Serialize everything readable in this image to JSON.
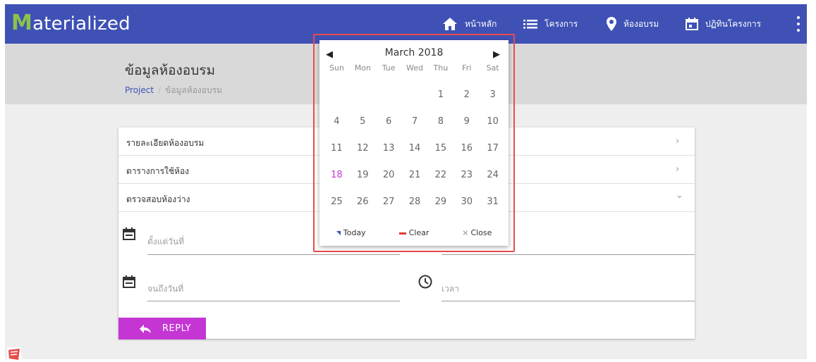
{
  "app": {
    "brand_first": "M",
    "brand_rest": "aterialized",
    "nav": [
      {
        "icon": "home-icon",
        "label": "หน้าหลัก"
      },
      {
        "icon": "list-icon",
        "label": "โครงการ"
      },
      {
        "icon": "location-pin-icon",
        "label": "ห้องอบรม"
      },
      {
        "icon": "calendar-icon",
        "label": "ปฏิทินโครงการ"
      }
    ],
    "colors": {
      "primary": "#3f51b5",
      "accent": "#c435d4",
      "brand_m": "#8bc34a",
      "highlight": "#e74c4c"
    }
  },
  "header": {
    "title": "ข้อมูลห้องอบรม",
    "breadcrumb": {
      "root": "Project",
      "separator": "/",
      "current": "ข้อมูลห้องอบรม"
    }
  },
  "accordion": [
    {
      "label": "รายละเอียดห้องอบรม",
      "chevron": "›"
    },
    {
      "label": "ตารางการใช้ห้อง",
      "chevron": "›"
    },
    {
      "label": "ตรวจสอบห้องว่าง",
      "chevron": "⌄"
    }
  ],
  "form": {
    "from_date_placeholder": "ตั้งแต่วันที่",
    "to_date_placeholder": "จนถึงวันที่",
    "time_placeholder": "เวลา",
    "reply_label": "REPLY"
  },
  "datepicker": {
    "month_label": "March 2018",
    "prev": "◀",
    "next": "▶",
    "weekdays": [
      "Sun",
      "Mon",
      "Tue",
      "Wed",
      "Thu",
      "Fri",
      "Sat"
    ],
    "weeks": [
      [
        "",
        "",
        "",
        "",
        "1",
        "2",
        "3"
      ],
      [
        "4",
        "5",
        "6",
        "7",
        "8",
        "9",
        "10"
      ],
      [
        "11",
        "12",
        "13",
        "14",
        "15",
        "16",
        "17"
      ],
      [
        "18",
        "19",
        "20",
        "21",
        "22",
        "23",
        "24"
      ],
      [
        "25",
        "26",
        "27",
        "28",
        "29",
        "30",
        "31"
      ]
    ],
    "today": "18",
    "today_label": "Today",
    "clear_label": "Clear",
    "close_label": "Close",
    "close_mark": "×"
  }
}
